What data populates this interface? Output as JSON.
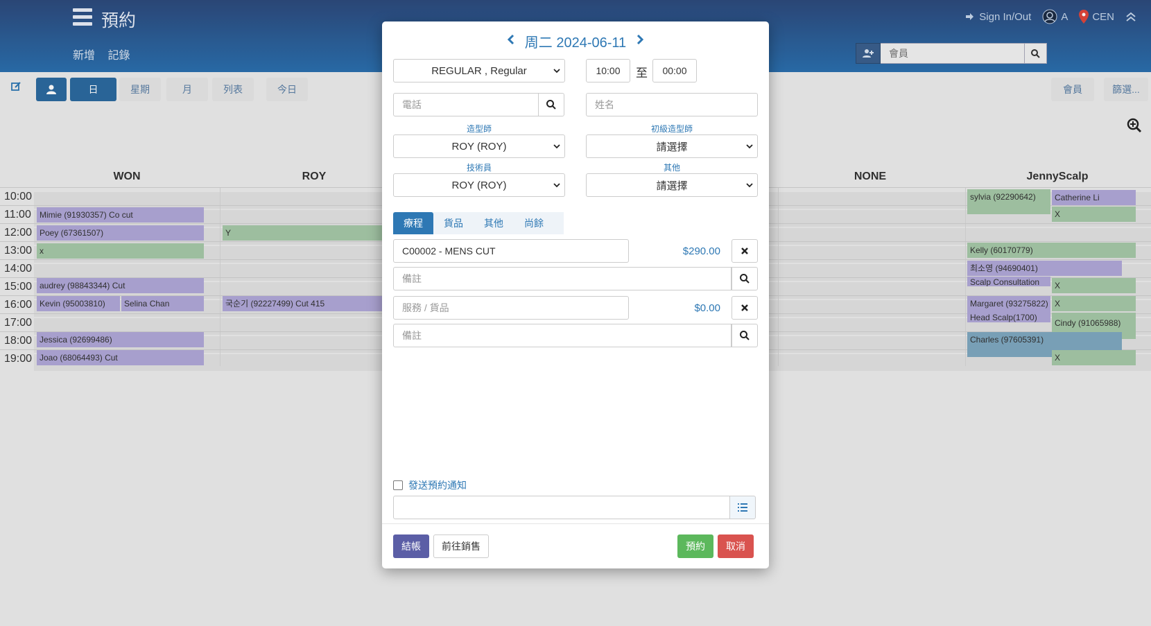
{
  "header": {
    "app_title": "預約",
    "nav": [
      "新增",
      "記錄"
    ],
    "sign_in_out": "Sign In/Out",
    "user": "A",
    "location": "CEN",
    "member_search_placeholder": "會員"
  },
  "toolbar": {
    "day": "日",
    "week": "星期",
    "month": "月",
    "list": "列表",
    "today": "今日",
    "member": "會員",
    "filter": "篩選..."
  },
  "calendar": {
    "columns": [
      "WON",
      "ROY",
      "NONE",
      "JennyScalp"
    ],
    "times": [
      "10:00",
      "11:00",
      "12:00",
      "13:00",
      "14:00",
      "15:00",
      "16:00",
      "17:00",
      "18:00",
      "19:00"
    ],
    "appointments": [
      {
        "text": "Mimie (91930357) Co cut"
      },
      {
        "text": "Poey (67361507)"
      },
      {
        "text": "x"
      },
      {
        "text": "audrey (98843344) Cut"
      },
      {
        "text": "Kevin (95003810)"
      },
      {
        "text": "Selina Chan"
      },
      {
        "text": "Jessica (92699486)"
      },
      {
        "text": "Joao (68064493) Cut"
      },
      {
        "text": "Y"
      },
      {
        "text": "국순기 (92227499) Cut 415"
      },
      {
        "text": "sylvia (92290642)"
      },
      {
        "text": "Catherine Li"
      },
      {
        "text": "X"
      },
      {
        "text": "Kelly (60170779)"
      },
      {
        "text": "최소영 (94690401)"
      },
      {
        "text": "Scalp Consultation"
      },
      {
        "text": "X"
      },
      {
        "text": "Margaret (93275822)"
      },
      {
        "text": "Head Scalp(1700)"
      },
      {
        "text": "X"
      },
      {
        "text": "Cindy (91065988)"
      },
      {
        "text": "Charles (97605391)"
      },
      {
        "text": "X"
      }
    ]
  },
  "modal": {
    "date_label": "周二 2024-06-11",
    "appointment_type": "REGULAR , Regular",
    "start_time": "10:00",
    "to_label": "至",
    "end_time": "00:00",
    "phone_placeholder": "電話",
    "name_placeholder": "姓名",
    "stylist_label": "造型師",
    "stylist_value": "ROY (ROY)",
    "junior_stylist_label": "初級造型師",
    "junior_stylist_value": "請選擇",
    "technician_label": "技術員",
    "technician_value": "ROY (ROY)",
    "other_label": "其他",
    "other_value": "請選擇",
    "tabs": [
      "療程",
      "貨品",
      "其他",
      "尚餘"
    ],
    "service_1": {
      "name": "C00002 - MENS CUT",
      "price": "$290.00",
      "remark_placeholder": "備註"
    },
    "service_2": {
      "placeholder": "服務 / 貨品",
      "price": "$0.00",
      "remark_placeholder": "備註"
    },
    "notify_label": "發送預約通知",
    "checkout": "結帳",
    "go_sales": "前往銷售",
    "book": "預約",
    "cancel": "取消"
  },
  "colors": {
    "header_top": "#2d4a7c",
    "header_bottom": "#2b6fae",
    "accent": "#2e78b4",
    "checkout_btn": "#5b5ea6",
    "book_btn": "#5cb85c",
    "cancel_btn": "#d9534f"
  }
}
